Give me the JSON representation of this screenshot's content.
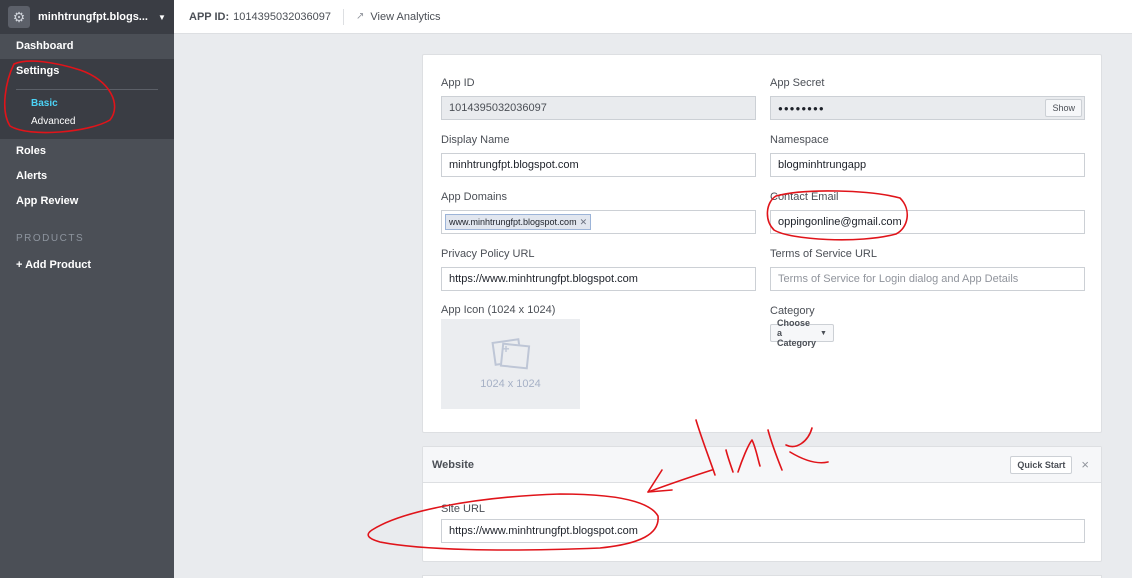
{
  "sidebar": {
    "app_name": "minhtrungfpt.blogs...",
    "items": {
      "dashboard": "Dashboard",
      "settings": "Settings",
      "basic": "Basic",
      "advanced": "Advanced",
      "roles": "Roles",
      "alerts": "Alerts",
      "app_review": "App Review"
    },
    "products_heading": "PRODUCTS",
    "add_product": "+ Add Product"
  },
  "topbar": {
    "app_id_label": "APP ID:",
    "app_id_value": "1014395032036097",
    "view_analytics": "View Analytics"
  },
  "basic": {
    "app_id": {
      "label": "App ID",
      "value": "1014395032036097"
    },
    "app_secret": {
      "label": "App Secret",
      "value": "●●●●●●●●",
      "show_label": "Show"
    },
    "display_name": {
      "label": "Display Name",
      "value": "minhtrungfpt.blogspot.com"
    },
    "namespace": {
      "label": "Namespace",
      "value": "blogminhtrungapp"
    },
    "app_domains": {
      "label": "App Domains",
      "token": "www.minhtrungfpt.blogspot.com"
    },
    "contact_email": {
      "label": "Contact Email",
      "value": "oppingonline@gmail.com"
    },
    "privacy_url": {
      "label": "Privacy Policy URL",
      "value": "https://www.minhtrungfpt.blogspot.com"
    },
    "tos_url": {
      "label": "Terms of Service URL",
      "placeholder": "Terms of Service for Login dialog and App Details"
    },
    "app_icon": {
      "label": "App Icon (1024 x 1024)",
      "size_text": "1024 x 1024"
    },
    "category": {
      "label": "Category",
      "value": "Choose a Category"
    }
  },
  "website": {
    "title": "Website",
    "quick_start": "Quick Start",
    "site_url": {
      "label": "Site URL",
      "value": "https://www.minhtrungfpt.blogspot.com"
    }
  },
  "annotation": {
    "text": "link"
  },
  "colors": {
    "sidebar_bg": "#4b4f56",
    "active_link": "#4cd3f6",
    "annotation": "#e0141a"
  }
}
